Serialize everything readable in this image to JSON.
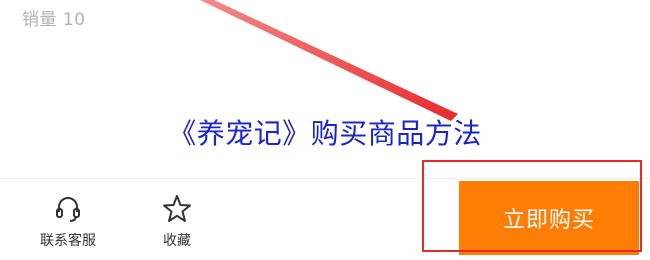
{
  "product": {
    "sales_text": "销量 10"
  },
  "overlay": {
    "title": "《养宠记》购买商品方法",
    "arrow_color": "#e82a2a",
    "highlight_color": "#e82a2a",
    "title_color": "#1a24c8"
  },
  "bottom_bar": {
    "service": {
      "label": "联系客服",
      "icon": "headset-icon"
    },
    "favorite": {
      "label": "收藏",
      "icon": "star-icon"
    },
    "buy_button": {
      "label": "立即购买",
      "color": "#ff7d05"
    }
  }
}
